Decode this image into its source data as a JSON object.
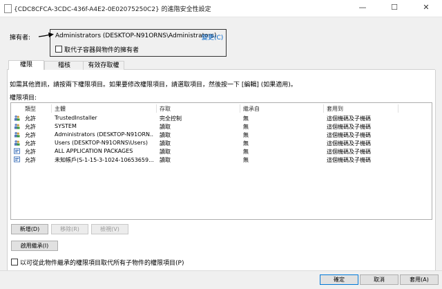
{
  "window": {
    "title": "{CDC8CFCA-3CDC-436f-A4E2-0E02075250C2} 的進階安全性設定",
    "minimize": "—",
    "maximize": "☐",
    "close": "✕"
  },
  "owner": {
    "label": "擁有者:",
    "value": "Administrators (DESKTOP-N91ORNS\\Administrators)",
    "change_link": "變更(C)",
    "replace_checkbox_label": "取代子容器與物件的擁有者",
    "replace_checked": false
  },
  "tabs": [
    {
      "label": "權限",
      "active": true
    },
    {
      "label": "稽核",
      "active": false
    },
    {
      "label": "有效存取權",
      "active": false
    }
  ],
  "info_text": "如需其他資訊，請按兩下權限項目。如果要修改權限項目，請選取項目，然後按一下 [編輯] (如果適用)。",
  "entries_label": "權限項目:",
  "columns": [
    "類型",
    "主體",
    "存取",
    "繼承自",
    "套用到"
  ],
  "rows": [
    {
      "icon": "users-icon",
      "type": "允許",
      "principal": "TrustedInstaller",
      "access": "完全控制",
      "inherited": "無",
      "applies": "這個機碼及子機碼"
    },
    {
      "icon": "users-icon",
      "type": "允許",
      "principal": "SYSTEM",
      "access": "讀取",
      "inherited": "無",
      "applies": "這個機碼及子機碼"
    },
    {
      "icon": "users-icon",
      "type": "允許",
      "principal": "Administrators (DESKTOP-N91ORN...",
      "access": "讀取",
      "inherited": "無",
      "applies": "這個機碼及子機碼"
    },
    {
      "icon": "users-icon",
      "type": "允許",
      "principal": "Users (DESKTOP-N91ORNS\\Users)",
      "access": "讀取",
      "inherited": "無",
      "applies": "這個機碼及子機碼"
    },
    {
      "icon": "package-icon",
      "type": "允許",
      "principal": "ALL APPLICATION PACKAGES",
      "access": "讀取",
      "inherited": "無",
      "applies": "這個機碼及子機碼"
    },
    {
      "icon": "package-icon",
      "type": "允許",
      "principal": "未知帳戶(S-1-15-3-1024-10653659...",
      "access": "讀取",
      "inherited": "無",
      "applies": "這個機碼及子機碼"
    }
  ],
  "buttons": {
    "add": "新增(D)",
    "remove": "移除(R)",
    "view": "檢視(V)",
    "enable_inheritance": "啟用繼承(I)",
    "ok": "確定",
    "cancel": "取消",
    "apply": "套用(A)"
  },
  "replace_children_label": "以可從此物件繼承的權限項目取代所有子物件的權限項目(P)",
  "replace_children_checked": false
}
